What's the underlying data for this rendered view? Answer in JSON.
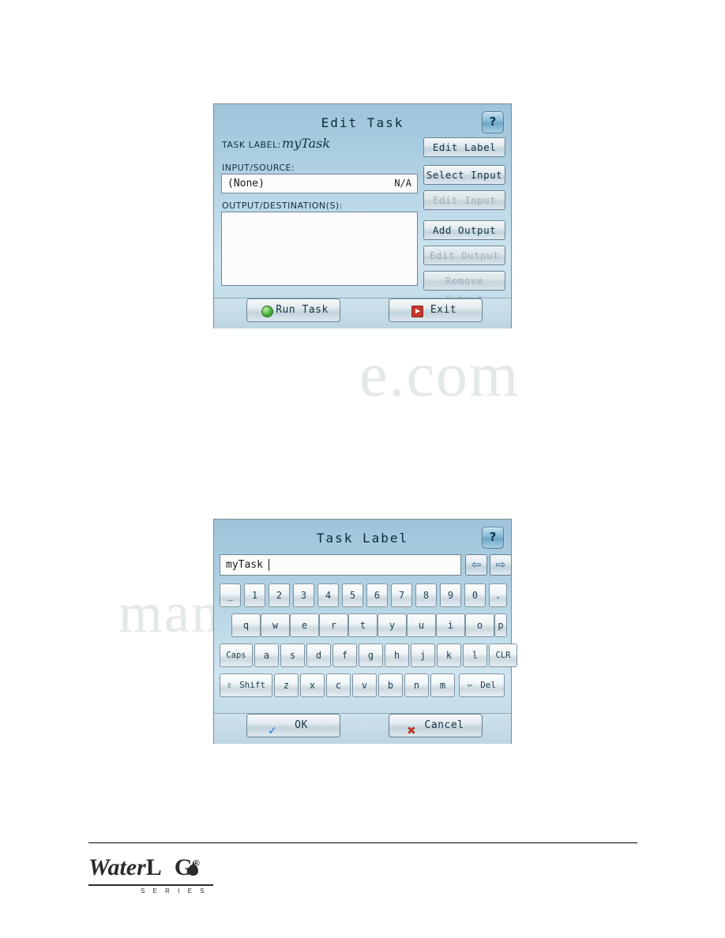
{
  "page": {
    "watermark_a": "e.com",
    "watermark_b": "manualshive"
  },
  "edit_task_dialog": {
    "title": "Edit Task",
    "help_icon": "?",
    "task_label_caption": "TASK LABEL:",
    "task_label_value": "myTask",
    "input_source_caption": "INPUT/SOURCE:",
    "input_source_value": "(None)",
    "input_source_status": "N/A",
    "output_caption": "OUTPUT/DESTINATION(S):",
    "output_value": "",
    "buttons": {
      "edit_label": "Edit Label",
      "select_input": "Select Input",
      "edit_input": "Edit Input",
      "add_output": "Add Output",
      "edit_output": "Edit Output",
      "remove_output": "Remove Output",
      "run_task": "Run Task",
      "exit": "Exit"
    }
  },
  "task_label_dialog": {
    "title": "Task Label",
    "help_icon": "?",
    "text_value": "myTask",
    "nav_left": "⇦",
    "nav_right": "⇨",
    "keys_row1": [
      "_",
      "1",
      "2",
      "3",
      "4",
      "5",
      "6",
      "7",
      "8",
      "9",
      "0",
      "."
    ],
    "keys_row2": [
      "q",
      "w",
      "e",
      "r",
      "t",
      "y",
      "u",
      "i",
      "o",
      "p"
    ],
    "keys_row3": [
      "Caps",
      "a",
      "s",
      "d",
      "f",
      "g",
      "h",
      "j",
      "k",
      "l",
      "CLR"
    ],
    "keys_row4": [
      "Shift",
      "z",
      "x",
      "c",
      "v",
      "b",
      "n",
      "m",
      "Del"
    ],
    "shift_glyph": "⇧",
    "del_glyph": "⇦",
    "ok_label": "OK",
    "cancel_label": "Cancel",
    "ok_icon": "✓",
    "cancel_icon": "✖"
  },
  "footer": {
    "logo_water": "Water",
    "logo_l": "L",
    "logo_g": "G",
    "logo_reg": "®",
    "logo_series": "S E R I E S"
  }
}
